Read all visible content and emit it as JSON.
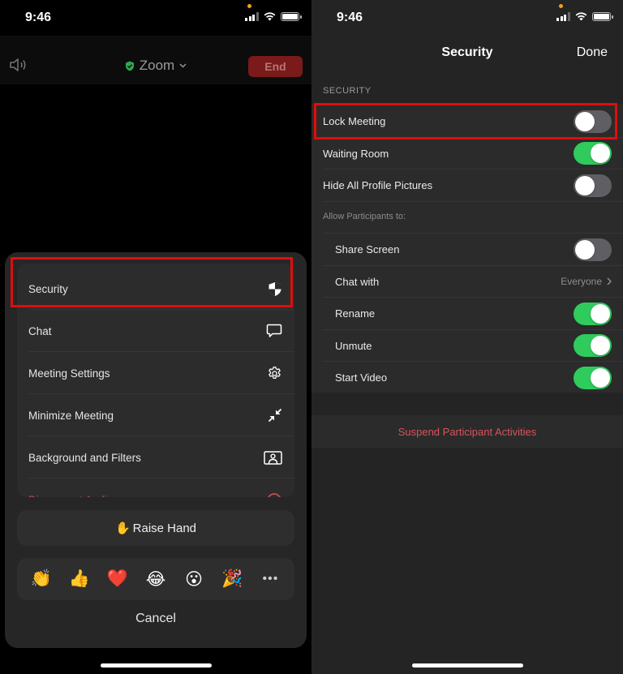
{
  "left": {
    "status": {
      "time": "9:46"
    },
    "meeting": {
      "title": "Zoom",
      "end_label": "End"
    },
    "menu": [
      {
        "label": "Security",
        "icon": "shield-icon",
        "danger": false
      },
      {
        "label": "Chat",
        "icon": "chat-bubble-icon",
        "danger": false
      },
      {
        "label": "Meeting Settings",
        "icon": "gear-icon",
        "danger": false
      },
      {
        "label": "Minimize Meeting",
        "icon": "minimize-arrows-icon",
        "danger": false
      },
      {
        "label": "Background and Filters",
        "icon": "portrait-frame-icon",
        "danger": false
      },
      {
        "label": "Disconnect Audio",
        "icon": "headphones-icon",
        "danger": true
      }
    ],
    "raise_hand": {
      "emoji": "✋",
      "label": "Raise Hand"
    },
    "reactions": [
      "👏",
      "👍",
      "❤️",
      "😂",
      "😮",
      "🎉"
    ],
    "more_label": "•••",
    "cancel_label": "Cancel"
  },
  "right": {
    "status": {
      "time": "9:46"
    },
    "nav": {
      "title": "Security",
      "done_label": "Done"
    },
    "section_header": "SECURITY",
    "security_rows": [
      {
        "label": "Lock Meeting",
        "on": false
      },
      {
        "label": "Waiting Room",
        "on": true
      },
      {
        "label": "Hide All Profile Pictures",
        "on": false
      }
    ],
    "allow_header": "Allow Participants to:",
    "participant_rows": [
      {
        "label": "Share Screen",
        "type": "toggle",
        "on": false
      },
      {
        "label": "Chat with",
        "type": "link",
        "value": "Everyone"
      },
      {
        "label": "Rename",
        "type": "toggle",
        "on": true
      },
      {
        "label": "Unmute",
        "type": "toggle",
        "on": true
      },
      {
        "label": "Start Video",
        "type": "toggle",
        "on": true
      }
    ],
    "suspend_label": "Suspend Participant Activities"
  },
  "colors": {
    "accent_green": "#2fcc5d",
    "danger_red": "#d8545a",
    "highlight_red": "#e00d0d",
    "shield_green": "#2ea84f"
  }
}
